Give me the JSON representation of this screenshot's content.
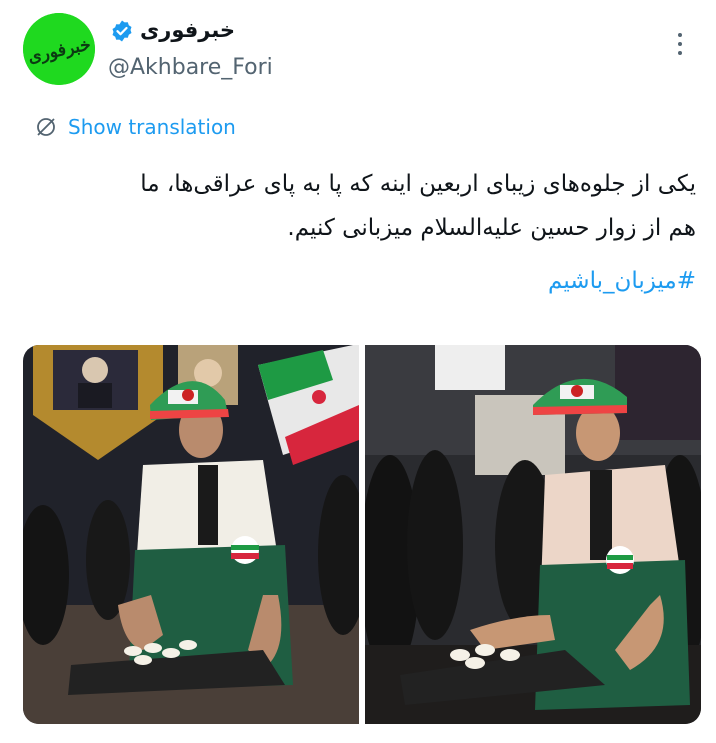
{
  "author": {
    "display_name": "خبرفوری",
    "handle": "@Akhbare_Fori",
    "avatar_text": "خبرفوری",
    "verified": true,
    "avatar_color": "#1fd91f"
  },
  "actions": {
    "more_icon": "more-dots-icon",
    "translate_label": "Show translation",
    "translate_icon": "globe-slash-icon"
  },
  "tweet": {
    "text_line1": "یکی از جلوه‌های زیبای اربعین اینه که پا به پای عراقی‌ها، ما",
    "text_line2": "هم از زوار حسین علیه‌السلام میزبانی کنیم.",
    "hashtag": "#میزبان_باشیم"
  },
  "colors": {
    "link": "#1d9bf0",
    "text": "#0f1419",
    "secondary": "#536471"
  }
}
